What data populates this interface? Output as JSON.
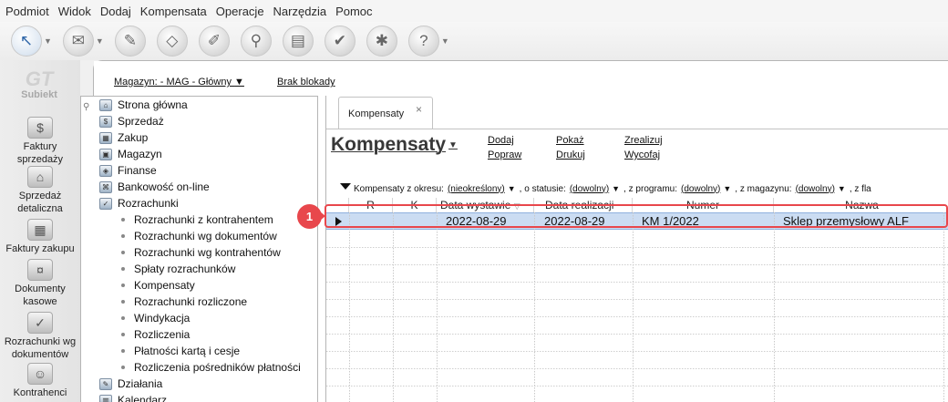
{
  "menu": [
    "Podmiot",
    "Widok",
    "Dodaj",
    "Kompensata",
    "Operacje",
    "Narzędzia",
    "Pomoc"
  ],
  "toolbar": {
    "buttons": [
      {
        "name": "select-icon",
        "glyph": "↖"
      },
      {
        "name": "mail-icon",
        "glyph": "✉"
      },
      {
        "name": "pencil-icon",
        "glyph": "✎"
      },
      {
        "name": "eraser-icon",
        "glyph": "◇"
      },
      {
        "name": "edit-doc-icon",
        "glyph": "✐"
      },
      {
        "name": "search-doc-icon",
        "glyph": "⚲"
      },
      {
        "name": "print-icon",
        "glyph": "▤"
      },
      {
        "name": "approve-icon",
        "glyph": "✔"
      },
      {
        "name": "tools-icon",
        "glyph": "✱"
      },
      {
        "name": "help-icon",
        "glyph": "?"
      }
    ]
  },
  "rail": {
    "logo_main": "GT",
    "logo_sub": "Subiekt",
    "items": [
      {
        "label": "Faktury sprzedaży",
        "icon": "coins-icon",
        "glyph": "$"
      },
      {
        "label": "Sprzedaż detaliczna",
        "icon": "register-icon",
        "glyph": "⌂"
      },
      {
        "label": "Faktury zakupu",
        "icon": "cart-icon",
        "glyph": "▦"
      },
      {
        "label": "Dokumenty kasowe",
        "icon": "cash-icon",
        "glyph": "¤"
      },
      {
        "label": "Rozrachunki wg dokumentów",
        "icon": "settlement-icon",
        "glyph": "✓"
      },
      {
        "label": "Kontrahenci",
        "icon": "person-icon",
        "glyph": "☺"
      }
    ]
  },
  "topbar": {
    "magazyn": "Magazyn: - MAG - Główny",
    "blokada": "Brak blokady"
  },
  "tree": {
    "top_items": [
      {
        "label": "Strona główna",
        "glyph": "⌂"
      },
      {
        "label": "Sprzedaż",
        "glyph": "$"
      },
      {
        "label": "Zakup",
        "glyph": "▦"
      },
      {
        "label": "Magazyn",
        "glyph": "▣"
      },
      {
        "label": "Finanse",
        "glyph": "◈"
      },
      {
        "label": "Bankowość on-line",
        "glyph": "⌘"
      },
      {
        "label": "Rozrachunki",
        "glyph": "✓"
      }
    ],
    "sub_items": [
      "Rozrachunki z kontrahentem",
      "Rozrachunki wg dokumentów",
      "Rozrachunki wg kontrahentów",
      "Spłaty rozrachunków",
      "Kompensaty",
      "Rozrachunki rozliczone",
      "Windykacja",
      "Rozliczenia",
      "Płatności kartą i cesje",
      "Rozliczenia pośredników płatności"
    ],
    "bottom_items": [
      {
        "label": "Działania",
        "glyph": "✎"
      },
      {
        "label": "Kalendarz",
        "glyph": "▥"
      }
    ]
  },
  "doc": {
    "tab_label": "Kompensaty",
    "tab_close": "×",
    "title": "Kompensaty",
    "actions": {
      "dodaj": "Dodaj",
      "popraw": "Popraw",
      "pokaz": "Pokaż",
      "drukuj": "Drukuj",
      "zrealizuj": "Zrealizuj",
      "wycofaj": "Wycofaj"
    },
    "filters": [
      {
        "label": "Kompensaty z okresu:",
        "value": "(nieokreślony)"
      },
      {
        "label": ", o statusie:",
        "value": "(dowolny)"
      },
      {
        "label": ", z programu:",
        "value": "(dowolny)"
      },
      {
        "label": ", z magazynu:",
        "value": "(dowolny)"
      },
      {
        "label": ", z fla",
        "value": ""
      }
    ]
  },
  "grid": {
    "columns": [
      "R",
      "K",
      "Data wystawie",
      "Data realizacji",
      "Numer",
      "Nazwa"
    ],
    "rows": [
      {
        "data_wystawienia": "2022-08-29",
        "data_realizacji": "2022-08-29",
        "numer": "KM 1/2022",
        "nazwa": "Sklep przemysłowy ALF"
      }
    ]
  },
  "callout": {
    "number": "1",
    "color": "#e8474c"
  },
  "colors": {
    "selected_row": "#cbdcf2",
    "callout": "#e8474c"
  }
}
